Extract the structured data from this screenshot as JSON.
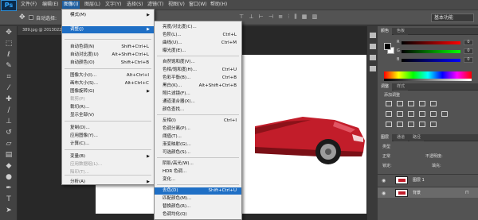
{
  "app": {
    "logo": "Ps"
  },
  "menubar": {
    "items": [
      "文件(F)",
      "编辑(E)",
      "图像(I)",
      "图层(L)",
      "文字(Y)",
      "选择(S)",
      "滤镜(T)",
      "视图(V)",
      "窗口(W)",
      "帮助(H)"
    ],
    "active_index": 2
  },
  "options": {
    "autoselect_label": "自动选择:",
    "workspace": "基本功能"
  },
  "document": {
    "tab_title": "389.jpg @ 2013022..."
  },
  "image_menu": {
    "items": [
      {
        "label": "模式(M)",
        "shortcut": "",
        "submenu": true,
        "disabled": false,
        "highlight": false
      },
      {
        "label": "调整(J)",
        "shortcut": "",
        "submenu": true,
        "disabled": false,
        "highlight": true
      },
      {
        "label": "自动色调(N)",
        "shortcut": "Shift+Ctrl+L",
        "submenu": false,
        "disabled": false,
        "highlight": false
      },
      {
        "label": "自动对比度(U)",
        "shortcut": "Alt+Shift+Ctrl+L",
        "submenu": false,
        "disabled": false,
        "highlight": false
      },
      {
        "label": "自动颜色(O)",
        "shortcut": "Shift+Ctrl+B",
        "submenu": false,
        "disabled": false,
        "highlight": false
      },
      {
        "label": "图像大小(I)...",
        "shortcut": "Alt+Ctrl+I",
        "submenu": false,
        "disabled": false,
        "highlight": false
      },
      {
        "label": "画布大小(S)...",
        "shortcut": "Alt+Ctrl+C",
        "submenu": false,
        "disabled": false,
        "highlight": false
      },
      {
        "label": "图像旋转(G)",
        "shortcut": "",
        "submenu": true,
        "disabled": false,
        "highlight": false
      },
      {
        "label": "裁剪(P)",
        "shortcut": "",
        "submenu": false,
        "disabled": true,
        "highlight": false
      },
      {
        "label": "裁切(R)...",
        "shortcut": "",
        "submenu": false,
        "disabled": false,
        "highlight": false
      },
      {
        "label": "显示全部(V)",
        "shortcut": "",
        "submenu": false,
        "disabled": false,
        "highlight": false
      },
      {
        "label": "复制(D)...",
        "shortcut": "",
        "submenu": false,
        "disabled": false,
        "highlight": false
      },
      {
        "label": "应用图像(Y)...",
        "shortcut": "",
        "submenu": false,
        "disabled": false,
        "highlight": false
      },
      {
        "label": "计算(C)...",
        "shortcut": "",
        "submenu": false,
        "disabled": false,
        "highlight": false
      },
      {
        "label": "变量(B)",
        "shortcut": "",
        "submenu": true,
        "disabled": false,
        "highlight": false
      },
      {
        "label": "应用数据组(L)...",
        "shortcut": "",
        "submenu": false,
        "disabled": true,
        "highlight": false
      },
      {
        "label": "陷印(T)...",
        "shortcut": "",
        "submenu": false,
        "disabled": true,
        "highlight": false
      },
      {
        "label": "分析(A)",
        "shortcut": "",
        "submenu": true,
        "disabled": false,
        "highlight": false
      }
    ]
  },
  "adjust_menu": {
    "items": [
      {
        "label": "亮度/对比度(C)...",
        "shortcut": "",
        "highlight": false
      },
      {
        "label": "色阶(L)...",
        "shortcut": "Ctrl+L",
        "highlight": false
      },
      {
        "label": "曲线(U)...",
        "shortcut": "Ctrl+M",
        "highlight": false
      },
      {
        "label": "曝光度(E)...",
        "shortcut": "",
        "highlight": false
      },
      {
        "label": "自然饱和度(V)...",
        "shortcut": "",
        "highlight": false
      },
      {
        "label": "色相/饱和度(H)...",
        "shortcut": "Ctrl+U",
        "highlight": false
      },
      {
        "label": "色彩平衡(B)...",
        "shortcut": "Ctrl+B",
        "highlight": false
      },
      {
        "label": "黑白(K)...",
        "shortcut": "Alt+Shift+Ctrl+B",
        "highlight": false
      },
      {
        "label": "照片滤镜(F)...",
        "shortcut": "",
        "highlight": false
      },
      {
        "label": "通道混合器(X)...",
        "shortcut": "",
        "highlight": false
      },
      {
        "label": "颜色查找...",
        "shortcut": "",
        "highlight": false
      },
      {
        "label": "反相(I)",
        "shortcut": "Ctrl+I",
        "highlight": false
      },
      {
        "label": "色调分离(P)...",
        "shortcut": "",
        "highlight": false
      },
      {
        "label": "阈值(T)...",
        "shortcut": "",
        "highlight": false
      },
      {
        "label": "渐变映射(G)...",
        "shortcut": "",
        "highlight": false
      },
      {
        "label": "可选颜色(S)...",
        "shortcut": "",
        "highlight": false
      },
      {
        "label": "阴影/高光(W)...",
        "shortcut": "",
        "highlight": false
      },
      {
        "label": "HDR 色调...",
        "shortcut": "",
        "highlight": false
      },
      {
        "label": "变化...",
        "shortcut": "",
        "highlight": false
      },
      {
        "label": "去色(D)",
        "shortcut": "Shift+Ctrl+U",
        "highlight": true
      },
      {
        "label": "匹配颜色(M)...",
        "shortcut": "",
        "highlight": false
      },
      {
        "label": "替换颜色(R)...",
        "shortcut": "",
        "highlight": false
      },
      {
        "label": "色调均化(Q)",
        "shortcut": "",
        "highlight": false
      }
    ]
  },
  "color_panel": {
    "tabs": [
      "颜色",
      "色板"
    ],
    "channels": [
      {
        "label": "R",
        "value": "0",
        "gradient": "#ff0000"
      },
      {
        "label": "G",
        "value": "0",
        "gradient": "#00ff00"
      },
      {
        "label": "B",
        "value": "0",
        "gradient": "#0000ff"
      }
    ]
  },
  "adjustments_panel": {
    "tabs": [
      "调整",
      "样式"
    ],
    "title": "添加调整"
  },
  "layers_panel": {
    "tabs": [
      "图层",
      "通道",
      "路径"
    ],
    "filter_label": "类型",
    "blend_mode": "正常",
    "opacity_label": "不透明度:",
    "lock_label": "锁定:",
    "fill_label": "填充:",
    "layers": [
      {
        "name": "图层 1",
        "locked": false
      },
      {
        "name": "背景",
        "locked": true
      }
    ]
  }
}
